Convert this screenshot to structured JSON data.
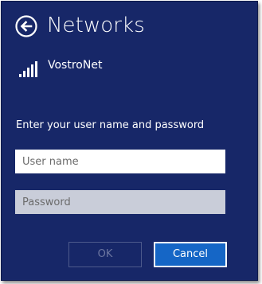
{
  "header": {
    "title": "Networks",
    "back_icon": "back-arrow-circle-icon"
  },
  "network": {
    "name": "VostroNet",
    "signal_icon": "wifi-signal-bars-icon",
    "signal_strength": "full"
  },
  "form": {
    "prompt": "Enter your user name and password",
    "username_placeholder": "User name",
    "username_value": "",
    "password_placeholder": "Password",
    "password_value": ""
  },
  "buttons": {
    "ok_label": "OK",
    "ok_enabled": false,
    "cancel_label": "Cancel"
  },
  "colors": {
    "panel_background": "#172768",
    "cancel_button": "#1566c6",
    "password_field": "#c9cdd9"
  }
}
